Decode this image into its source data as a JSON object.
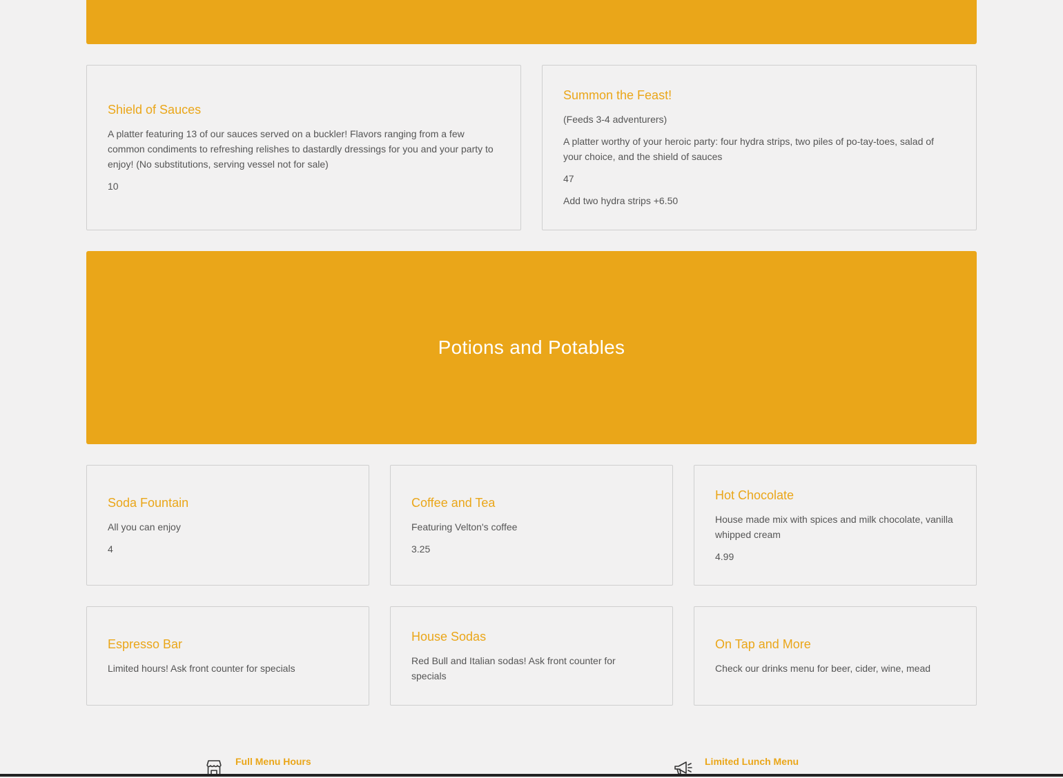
{
  "colors": {
    "accent": "#eaa619",
    "background": "#f2f1f1",
    "text": "#555555",
    "heading_on_banner": "#ffffff"
  },
  "platters": [
    {
      "title": "Shield of Sauces",
      "lines": [
        "A platter featuring 13 of our sauces served on a buckler! Flavors ranging from a few common condiments to refreshing relishes to dastardly dressings for you and your party to enjoy! (No substitutions, serving vessel not for sale)",
        "10"
      ]
    },
    {
      "title": "Summon the Feast!",
      "lines": [
        "(Feeds 3-4 adventurers)",
        "A platter worthy of your heroic party: four hydra strips, two piles of po-tay-toes, salad of your choice, and the shield of sauces",
        "47",
        "Add two hydra strips +6.50"
      ]
    }
  ],
  "drinks_section": {
    "title": "Potions and Potables"
  },
  "drinks": [
    {
      "title": "Soda Fountain",
      "lines": [
        "All you can enjoy",
        "4"
      ]
    },
    {
      "title": "Coffee and Tea",
      "lines": [
        "Featuring Velton's coffee",
        "3.25"
      ]
    },
    {
      "title": "Hot Chocolate",
      "lines": [
        "House made mix with spices and milk chocolate, vanilla whipped cream",
        "4.99"
      ]
    },
    {
      "title": "Espresso Bar",
      "lines": [
        "Limited hours! Ask front counter for specials"
      ]
    },
    {
      "title": "House Sodas",
      "lines": [
        "Red Bull and Italian sodas! Ask front counter for specials"
      ]
    },
    {
      "title": "On Tap and More",
      "lines": [
        "Check our drinks menu for beer, cider, wine, mead"
      ]
    }
  ],
  "footer": {
    "items": [
      {
        "label": "Full Menu Hours",
        "icon": "storefront-icon"
      },
      {
        "label": "Limited Lunch Menu",
        "icon": "megaphone-icon"
      }
    ]
  }
}
